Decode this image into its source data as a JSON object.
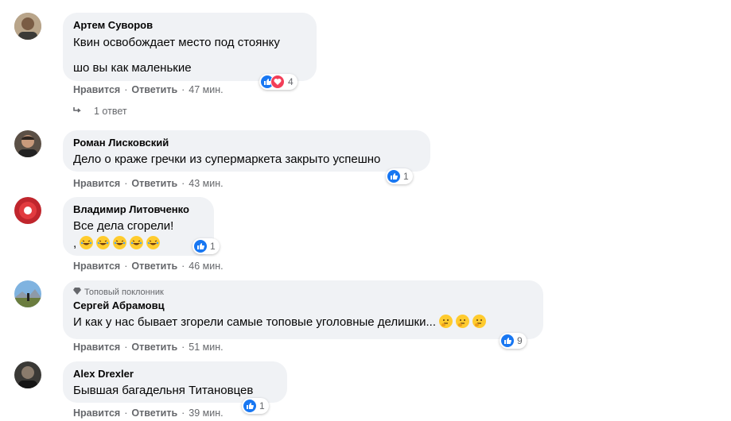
{
  "actions": {
    "like": "Нравится",
    "reply": "Ответить",
    "separator": "·"
  },
  "comments": [
    {
      "author": "Артем Суворов",
      "lines": [
        "Квин освобождает место под стоянку",
        "шо вы как маленькие"
      ],
      "time": "47 мин.",
      "reactions": [
        "like",
        "love"
      ],
      "reaction_count": "4",
      "replies": "1 ответ"
    },
    {
      "author": "Роман Лисковский",
      "lines": [
        "Дело о краже гречки из супермаркета закрыто успешно"
      ],
      "time": "43 мин.",
      "reactions": [
        "like"
      ],
      "reaction_count": "1"
    },
    {
      "author": "Владимир Литовченко",
      "lines": [
        "Все дела сгорели!",
        ","
      ],
      "emoji_line": {
        "icon": "laughing-emoji",
        "count": 5
      },
      "time": "46 мин.",
      "reactions": [
        "like"
      ],
      "reaction_count": "1"
    },
    {
      "badge": "Топовый поклонник",
      "author": "Сергей Абрамовц",
      "lines": [
        "И как у нас бывает згорели самые топовые уголовные делишки..."
      ],
      "trailing_emoji": {
        "icon": "thinking-emoji",
        "count": 3
      },
      "time": "51 мин.",
      "reactions": [
        "like"
      ],
      "reaction_count": "9"
    },
    {
      "author": "Alex Drexler",
      "lines": [
        "Бывшая багадельня Титановцев"
      ],
      "time": "39 мин.",
      "reactions": [
        "like"
      ],
      "reaction_count": "1"
    }
  ],
  "colors": {
    "like": "#1877f2",
    "love": "#f33e58",
    "bubble": "#f0f2f5",
    "meta": "#65676b"
  }
}
